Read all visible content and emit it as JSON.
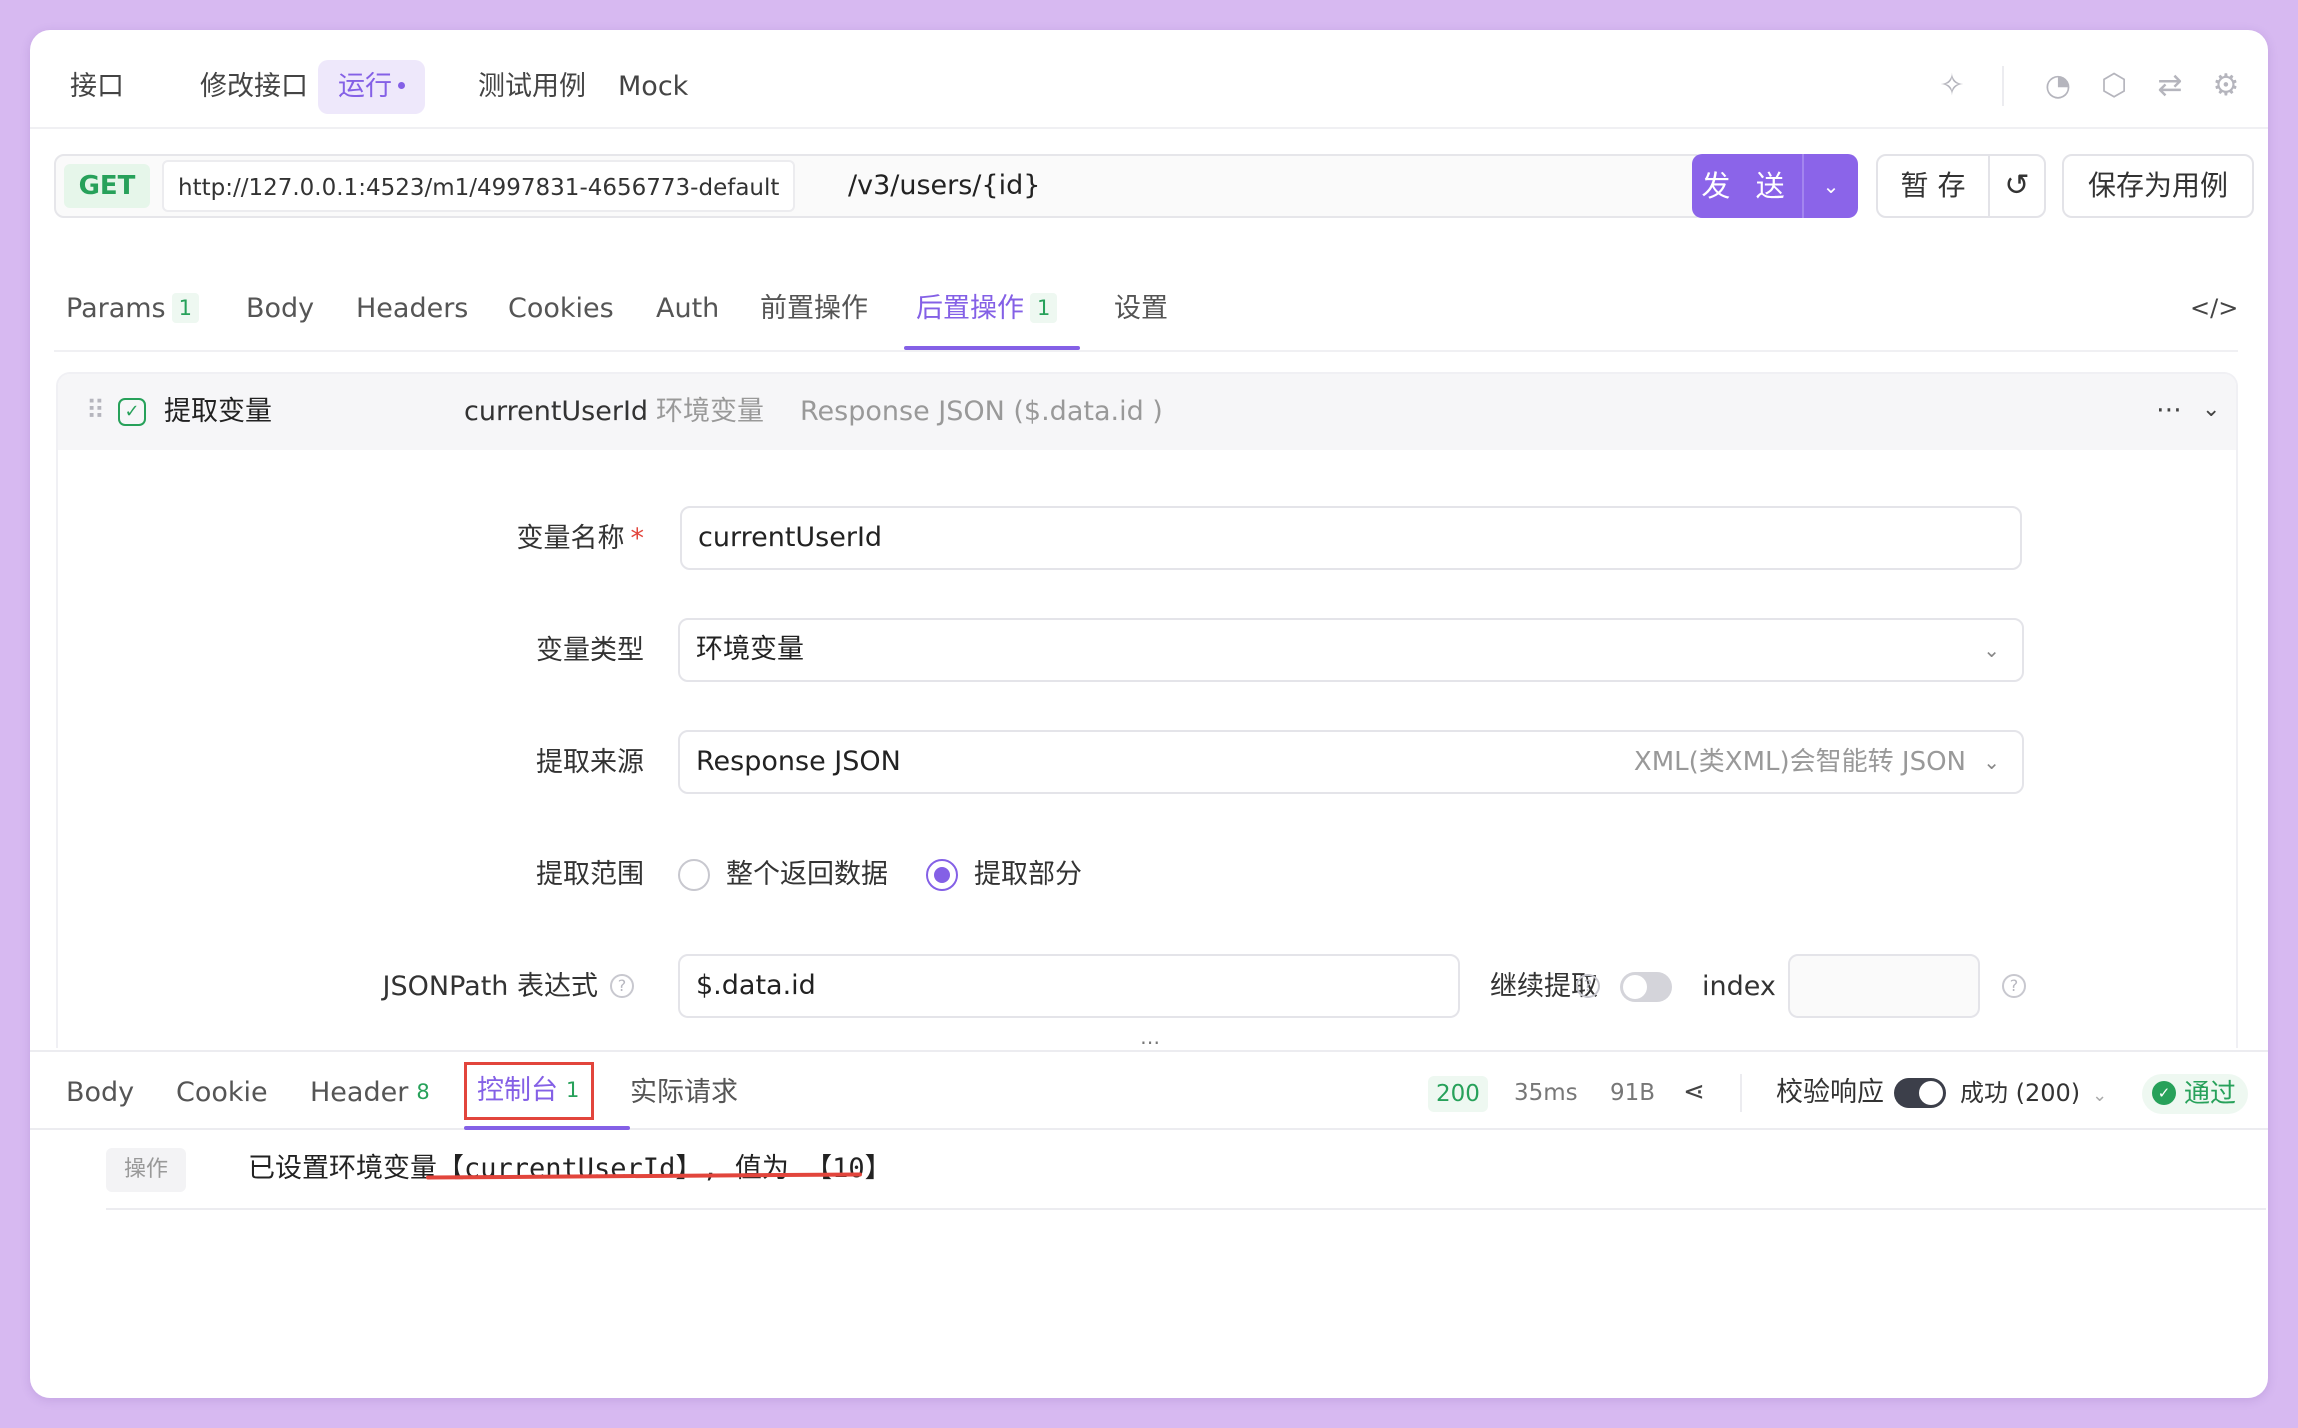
{
  "top_tabs": {
    "interface": "接口",
    "edit_interface": "修改接口",
    "run": "运行",
    "test_cases": "测试用例",
    "mock": "Mock"
  },
  "icons": {
    "right_toolbar": [
      "sparkle-icon",
      "timer-icon",
      "tag-icon",
      "flow-icon",
      "settings-icon"
    ]
  },
  "request": {
    "method": "GET",
    "base_url": "http://127.0.0.1:4523/m1/4997831-4656773-default",
    "path": "/v3/users/{id}",
    "send_label": "发 送",
    "save_temp_label": "暂 存",
    "save_case_label": "保存为用例"
  },
  "request_tabs": {
    "params": "Params",
    "params_count": "1",
    "body": "Body",
    "headers": "Headers",
    "cookies": "Cookies",
    "auth": "Auth",
    "pre_ops": "前置操作",
    "post_ops": "后置操作",
    "post_ops_count": "1",
    "settings": "设置"
  },
  "extract_panel": {
    "title": "提取变量",
    "summary_name": "currentUserId",
    "summary_type": "环境变量",
    "summary_source": "Response JSON ($.data.id )",
    "fields": {
      "var_name_label": "变量名称",
      "var_name_required": "*",
      "var_name_value": "currentUserId",
      "var_type_label": "变量类型",
      "var_type_value": "环境变量",
      "source_label": "提取来源",
      "source_value": "Response JSON",
      "source_hint": "XML(类XML)会智能转 JSON",
      "scope_label": "提取范围",
      "scope_option_all": "整个返回数据",
      "scope_option_part": "提取部分",
      "scope_selected": "提取部分",
      "jsonpath_label": "JSONPath 表达式",
      "jsonpath_value": "$.data.id",
      "continue_label": "继续提取",
      "index_label": "index",
      "index_value": ""
    }
  },
  "response_tabs": {
    "body": "Body",
    "cookie": "Cookie",
    "header": "Header",
    "header_count": "8",
    "console": "控制台",
    "console_count": "1",
    "actual_request": "实际请求"
  },
  "response_status": {
    "code": "200",
    "time": "35ms",
    "size": "91B",
    "validate_label": "校验响应",
    "validate_enabled": true,
    "result_select": "成功 (200)",
    "pass_label": "通过"
  },
  "console": {
    "entry_tag": "操作",
    "entry_text": "已设置环境变量【currentUserId】, 值为 【10】"
  },
  "colors": {
    "accent": "#8460e6",
    "success": "#27a15a",
    "highlight_red": "#e2453c",
    "background": "#d7b9f1"
  }
}
